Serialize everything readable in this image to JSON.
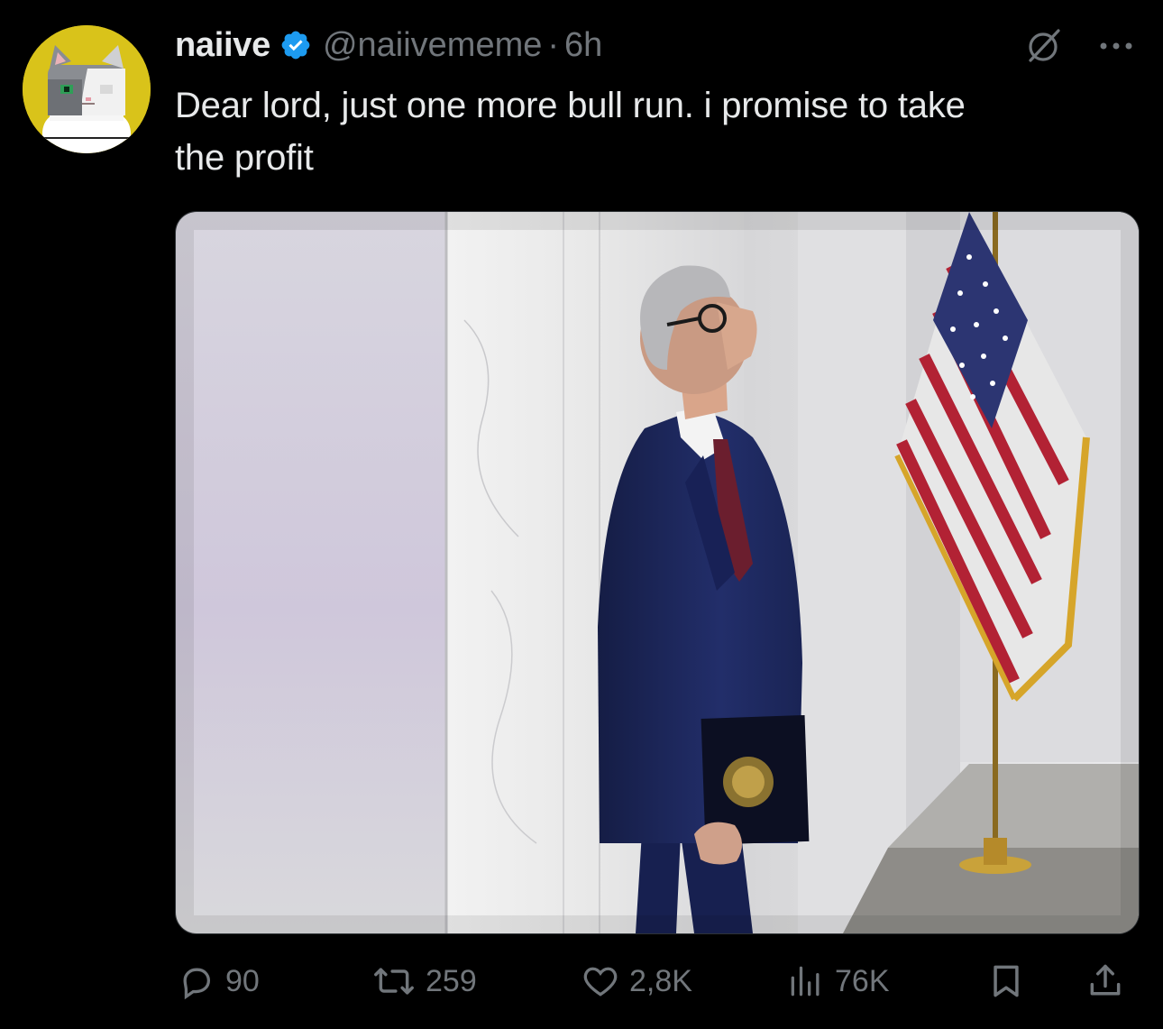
{
  "tweet": {
    "display_name": "naiive",
    "handle": "@naiivememe",
    "separator": "·",
    "time": "6h",
    "text_line_1": "Dear lord, just one more bull run. i promise to take",
    "text_line_2": "the profit",
    "verified": true,
    "verified_color": "#1d9bf0",
    "avatar_bg": "#d9c31a",
    "avatar_icon": "pixel-cat-avatar",
    "media_description_icon": "photo"
  },
  "actions": {
    "reply": {
      "icon": "reply-icon",
      "count": "90"
    },
    "retweet": {
      "icon": "retweet-icon",
      "count": "259"
    },
    "like": {
      "icon": "heart-icon",
      "count": "2,8K"
    },
    "views": {
      "icon": "analytics-icon",
      "count": "76K"
    },
    "bookmark": {
      "icon": "bookmark-icon"
    },
    "share": {
      "icon": "share-icon"
    }
  },
  "top_actions": {
    "grok": {
      "icon": "grok-icon"
    },
    "more": {
      "icon": "more-icon"
    }
  },
  "colors": {
    "background": "#000000",
    "text_primary": "#e7e9ea",
    "text_secondary": "#71767b"
  }
}
